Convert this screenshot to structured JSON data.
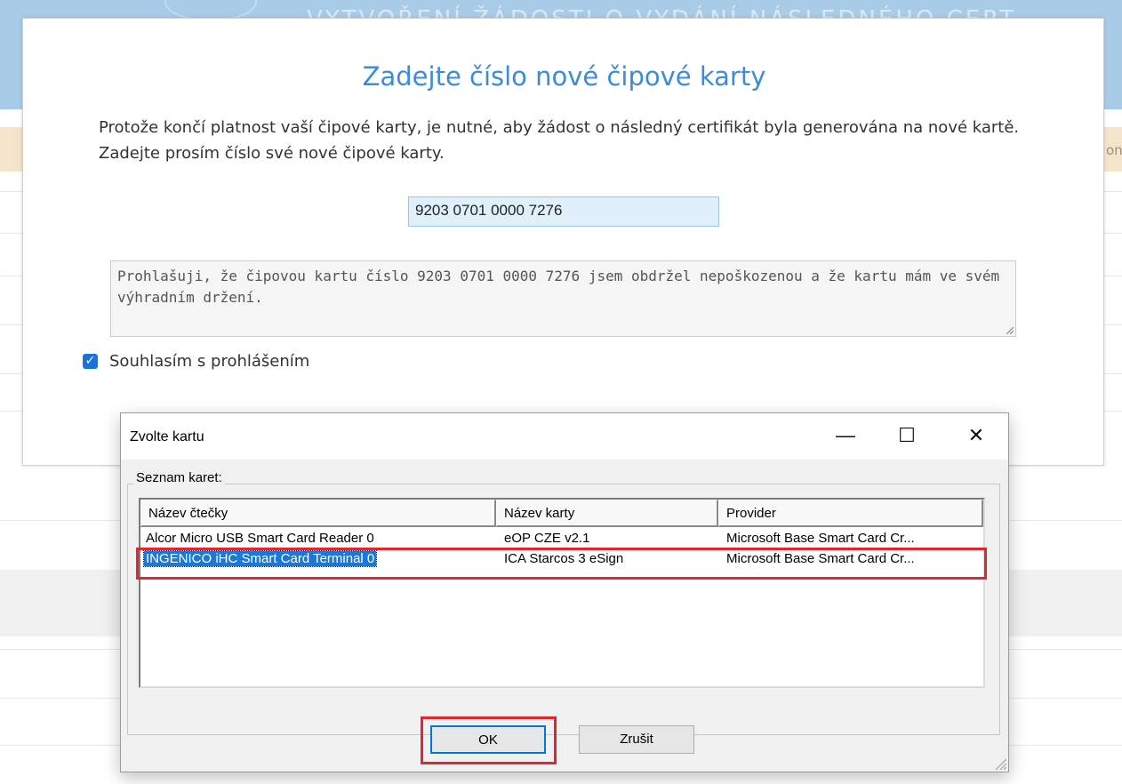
{
  "background": {
    "header_title": "VYTVOŘENÍ ŽÁDOSTI O VYDÁNÍ NÁSLEDNÉHO CERTIFIKÁTU",
    "band_text": "on"
  },
  "modal": {
    "title": "Zadejte číslo nové čipové karty",
    "description": "Protože končí platnost vaší čipové karty, je nutné, aby žádost o následný certifikát byla generována na nové kartě. Zadejte prosím číslo své nové čipové karty.",
    "card_number": "9203 0701 0000 7276",
    "declaration": "Prohlašuji, že čipovou kartu číslo 9203 0701 0000 7276 jsem obdržel nepoškozenou a že kartu mám ve svém výhradním držení.",
    "agree_checked": true,
    "agree_label": "Souhlasím s prohlášením"
  },
  "dialog": {
    "title": "Zvolte kartu",
    "controls": {
      "minimize": "—",
      "maximize": "☐",
      "close": "✕"
    },
    "group_label": "Seznam karet:",
    "columns": [
      "Název čtečky",
      "Název karty",
      "Provider"
    ],
    "rows": [
      {
        "reader": "Alcor Micro USB Smart Card Reader 0",
        "card": "eOP CZE v2.1",
        "provider": "Microsoft Base Smart Card Cr...",
        "selected": false
      },
      {
        "reader": "INGENICO iHC Smart Card Terminal 0",
        "card": "ICA Starcos 3 eSign",
        "provider": "Microsoft Base Smart Card Cr...",
        "selected": true
      }
    ],
    "ok_label": "OK",
    "cancel_label": "Zrušit"
  },
  "colors": {
    "title_blue": "#3a8dd8",
    "selection_blue": "#1b78d6",
    "highlight_red": "#e2262f"
  }
}
